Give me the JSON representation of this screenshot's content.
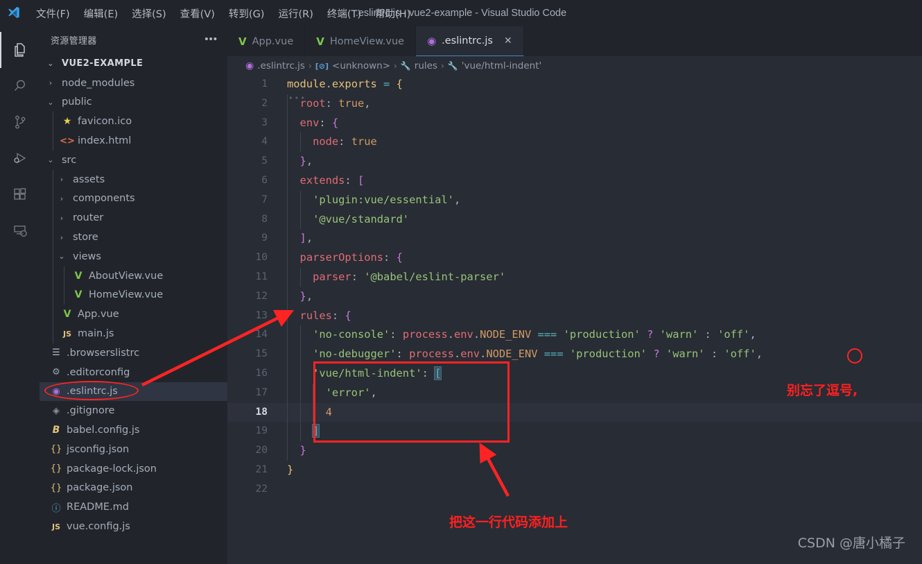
{
  "window": {
    "title": ".eslintrc.js - vue2-example - Visual Studio Code",
    "logo_icon": "vscode-logo-icon"
  },
  "menubar": {
    "items": [
      {
        "label": "文件(F)",
        "name": "menu-file"
      },
      {
        "label": "编辑(E)",
        "name": "menu-edit"
      },
      {
        "label": "选择(S)",
        "name": "menu-selection"
      },
      {
        "label": "查看(V)",
        "name": "menu-view"
      },
      {
        "label": "转到(G)",
        "name": "menu-go"
      },
      {
        "label": "运行(R)",
        "name": "menu-run"
      },
      {
        "label": "终端(T)",
        "name": "menu-terminal"
      },
      {
        "label": "帮助(H)",
        "name": "menu-help"
      }
    ]
  },
  "activitybar": {
    "items": [
      {
        "icon": "files-explorer-icon",
        "active": true
      },
      {
        "icon": "search-icon",
        "active": false
      },
      {
        "icon": "source-control-icon",
        "active": false
      },
      {
        "icon": "run-and-debug-icon",
        "active": false
      },
      {
        "icon": "extensions-icon",
        "active": false
      },
      {
        "icon": "remote-explorer-icon",
        "active": false
      }
    ]
  },
  "sidebar": {
    "title": "资源管理器",
    "more_icon": "ellipsis-icon",
    "root": {
      "label": "VUE2-EXAMPLE",
      "expanded": true
    },
    "tree": [
      {
        "label": "node_modules",
        "kind": "folder",
        "expanded": false,
        "depth": 1
      },
      {
        "label": "public",
        "kind": "folder",
        "expanded": true,
        "depth": 1
      },
      {
        "label": "favicon.ico",
        "kind": "star",
        "depth": 2
      },
      {
        "label": "index.html",
        "kind": "html",
        "depth": 2
      },
      {
        "label": "src",
        "kind": "folder",
        "expanded": true,
        "depth": 1
      },
      {
        "label": "assets",
        "kind": "folder",
        "expanded": false,
        "depth": 2
      },
      {
        "label": "components",
        "kind": "folder",
        "expanded": false,
        "depth": 2
      },
      {
        "label": "router",
        "kind": "folder",
        "expanded": false,
        "depth": 2
      },
      {
        "label": "store",
        "kind": "folder",
        "expanded": false,
        "depth": 2
      },
      {
        "label": "views",
        "kind": "folder",
        "expanded": true,
        "depth": 2
      },
      {
        "label": "AboutView.vue",
        "kind": "vue",
        "depth": 3
      },
      {
        "label": "HomeView.vue",
        "kind": "vue",
        "depth": 3
      },
      {
        "label": "App.vue",
        "kind": "vue",
        "depth": 2
      },
      {
        "label": "main.js",
        "kind": "js",
        "depth": 2
      },
      {
        "label": ".browserslistrc",
        "kind": "list",
        "depth": 1
      },
      {
        "label": ".editorconfig",
        "kind": "gear",
        "depth": 1
      },
      {
        "label": ".eslintrc.js",
        "kind": "eslint",
        "depth": 1,
        "selected": true
      },
      {
        "label": ".gitignore",
        "kind": "git",
        "depth": 1
      },
      {
        "label": "babel.config.js",
        "kind": "babel",
        "depth": 1
      },
      {
        "label": "jsconfig.json",
        "kind": "json",
        "depth": 1
      },
      {
        "label": "package-lock.json",
        "kind": "json",
        "depth": 1
      },
      {
        "label": "package.json",
        "kind": "json",
        "depth": 1
      },
      {
        "label": "README.md",
        "kind": "md",
        "depth": 1
      },
      {
        "label": "vue.config.js",
        "kind": "js",
        "depth": 1
      }
    ]
  },
  "tabs": [
    {
      "label": "App.vue",
      "icon": "vue-file-icon",
      "active": false,
      "closable": false
    },
    {
      "label": "HomeView.vue",
      "icon": "vue-file-icon",
      "active": false,
      "closable": false
    },
    {
      "label": ".eslintrc.js",
      "icon": "eslint-file-icon",
      "active": true,
      "closable": true,
      "close_label": "✕"
    }
  ],
  "breadcrumb": [
    {
      "label": ".eslintrc.js",
      "icon": "eslint-file-icon"
    },
    {
      "label": "<unknown>",
      "icon": "module-box-icon"
    },
    {
      "label": "rules",
      "icon": "wrench-icon"
    },
    {
      "label": "'vue/html-indent'",
      "icon": "wrench-icon"
    }
  ],
  "editor": {
    "active_line": 18,
    "total_lines": 22,
    "lines": [
      {
        "n": 1,
        "text": "module.exports = {"
      },
      {
        "n": 2,
        "text": "  root: true,"
      },
      {
        "n": 3,
        "text": "  env: {"
      },
      {
        "n": 4,
        "text": "    node: true"
      },
      {
        "n": 5,
        "text": "  },"
      },
      {
        "n": 6,
        "text": "  extends: ["
      },
      {
        "n": 7,
        "text": "    'plugin:vue/essential',"
      },
      {
        "n": 8,
        "text": "    '@vue/standard'"
      },
      {
        "n": 9,
        "text": "  ],"
      },
      {
        "n": 10,
        "text": "  parserOptions: {"
      },
      {
        "n": 11,
        "text": "    parser: '@babel/eslint-parser'"
      },
      {
        "n": 12,
        "text": "  },"
      },
      {
        "n": 13,
        "text": "  rules: {"
      },
      {
        "n": 14,
        "text": "    'no-console': process.env.NODE_ENV === 'production' ? 'warn' : 'off',"
      },
      {
        "n": 15,
        "text": "    'no-debugger': process.env.NODE_ENV === 'production' ? 'warn' : 'off',"
      },
      {
        "n": 16,
        "text": "    'vue/html-indent': ["
      },
      {
        "n": 17,
        "text": "      'error',"
      },
      {
        "n": 18,
        "text": "      4"
      },
      {
        "n": 19,
        "text": "    ]"
      },
      {
        "n": 20,
        "text": "  }"
      },
      {
        "n": 21,
        "text": "}"
      },
      {
        "n": 22,
        "text": ""
      }
    ]
  },
  "annotations": {
    "color": "#ff2424",
    "comma_note": "别忘了逗号,",
    "add_line_note": "把这一行代码添加上"
  },
  "watermark": "CSDN @唐小橘子"
}
